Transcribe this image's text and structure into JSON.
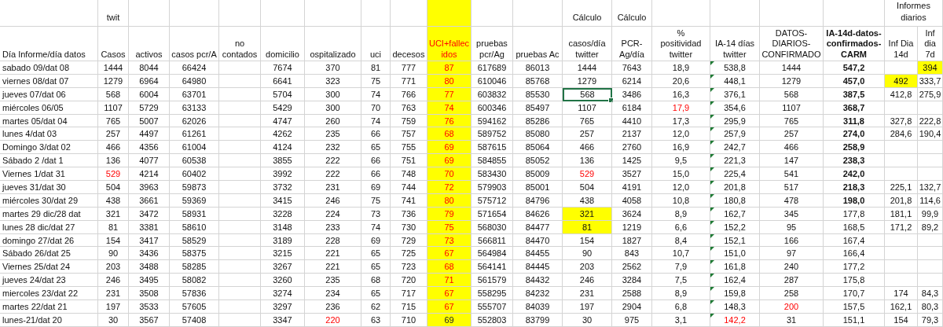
{
  "columns": [
    {
      "lines": [
        "Día Informe/día datos"
      ],
      "kind": "label"
    },
    {
      "lines": [
        "Casos"
      ],
      "kind": "plain",
      "group": "twit"
    },
    {
      "lines": [
        "activos"
      ],
      "kind": "plain"
    },
    {
      "lines": [
        "casos pcr/A"
      ],
      "kind": "plain"
    },
    {
      "lines": [
        "no",
        "contados"
      ],
      "kind": "plain"
    },
    {
      "lines": [
        "domicilio"
      ],
      "kind": "plain"
    },
    {
      "lines": [
        "ospitalizado"
      ],
      "kind": "plain"
    },
    {
      "lines": [
        "uci"
      ],
      "kind": "plain"
    },
    {
      "lines": [
        "decesos"
      ],
      "kind": "plain"
    },
    {
      "lines": [
        "UCI+fallec",
        "idos"
      ],
      "kind": "highlight"
    },
    {
      "lines": [
        "pruebas",
        "pcr/Ag"
      ],
      "kind": "plain"
    },
    {
      "lines": [
        "pruebas Ac"
      ],
      "kind": "plain"
    },
    {
      "lines": [
        "casos/día",
        "twitter"
      ],
      "kind": "plain",
      "group": "Cálculo"
    },
    {
      "lines": [
        "PCR-",
        "Ag/día"
      ],
      "kind": "plain",
      "group": "Cálculo"
    },
    {
      "lines": [
        "%",
        "positividad",
        "twitter"
      ],
      "kind": "plain"
    },
    {
      "lines": [
        "IA-14 días",
        "twitter"
      ],
      "kind": "notes"
    },
    {
      "lines": [
        "DATOS-",
        "DIARIOS-",
        "CONFIRMADO"
      ],
      "kind": "plain"
    },
    {
      "lines": [
        "IA-14d-datos-",
        "confirmados-",
        "CARM"
      ],
      "kind": "bold"
    },
    {
      "lines": [
        "Inf Dia",
        "14d"
      ],
      "kind": "plain",
      "group": "Informes diarios",
      "group_wide": true
    },
    {
      "lines": [
        "Inf",
        "dia",
        "7d"
      ],
      "kind": "plain"
    }
  ],
  "rows": [
    {
      "cells": [
        "sabado 09/dat 08",
        "1444",
        "8044",
        "66424",
        null,
        "7674",
        "370",
        "81",
        "777",
        "87",
        "617689",
        "86013",
        "1444",
        "7643",
        "18,9",
        "538,8",
        "1444",
        {
          "text": "547,2",
          "kind": "bold"
        },
        null,
        {
          "text": "394",
          "kind": "highlight"
        }
      ]
    },
    {
      "cells": [
        "viernes 08/dat 07",
        "1279",
        "6964",
        "64980",
        null,
        "6641",
        "323",
        "75",
        "771",
        "80",
        "610046",
        "85768",
        "1279",
        "6214",
        "20,6",
        "448,1",
        "1279",
        {
          "text": "457,0",
          "kind": "bold"
        },
        {
          "text": "492",
          "kind": "highlight"
        },
        "333,7"
      ]
    },
    {
      "cells": [
        "jueves 07/dat 06",
        "568",
        "6004",
        "63701",
        null,
        "5704",
        "300",
        "74",
        "766",
        "77",
        "603832",
        "85530",
        {
          "text": "568",
          "kind": "selected"
        },
        "3486",
        "16,3",
        "376,1",
        "568",
        {
          "text": "387,5",
          "kind": "bold"
        },
        "412,8",
        "275,9"
      ]
    },
    {
      "cells": [
        "miércoles 06/05",
        "1107",
        "5729",
        "63133",
        null,
        "5429",
        "300",
        "70",
        "763",
        "74",
        "600346",
        "85497",
        "1107",
        "6184",
        {
          "text": "17,9",
          "kind": "red"
        },
        "354,6",
        "1107",
        {
          "text": "368,7",
          "kind": "bold"
        },
        null,
        null
      ]
    },
    {
      "cells": [
        "martes 05/dat 04",
        "765",
        "5007",
        "62026",
        null,
        "4747",
        "260",
        "74",
        "759",
        "76",
        "594162",
        "85286",
        "765",
        "4410",
        "17,3",
        "295,9",
        "765",
        {
          "text": "311,8",
          "kind": "bold"
        },
        "327,8",
        "222,8"
      ]
    },
    {
      "cells": [
        "lunes 4/dat 03",
        "257",
        "4497",
        "61261",
        null,
        "4262",
        "235",
        "66",
        "757",
        "68",
        "589752",
        "85080",
        "257",
        "2137",
        "12,0",
        "257,9",
        "257",
        {
          "text": "274,0",
          "kind": "bold"
        },
        "284,6",
        "190,4"
      ]
    },
    {
      "cells": [
        "Domingo 3/dat 02",
        "466",
        "4356",
        "61004",
        null,
        "4124",
        "232",
        "65",
        "755",
        "69",
        "587615",
        "85064",
        "466",
        "2760",
        "16,9",
        "242,7",
        "466",
        {
          "text": "258,9",
          "kind": "bold"
        },
        null,
        null
      ]
    },
    {
      "cells": [
        "Sábado 2 /dat 1",
        "136",
        "4077",
        "60538",
        null,
        "3855",
        "222",
        "66",
        "751",
        "69",
        "584855",
        "85052",
        "136",
        "1425",
        "9,5",
        "221,3",
        "147",
        {
          "text": "238,3",
          "kind": "bold"
        },
        null,
        null
      ]
    },
    {
      "cells": [
        "Viernes 1/dat 31",
        {
          "text": "529",
          "kind": "red"
        },
        "4214",
        "60402",
        null,
        "3992",
        "222",
        "66",
        "748",
        "70",
        "583430",
        "85009",
        {
          "text": "529",
          "kind": "red"
        },
        "3527",
        "15,0",
        "225,4",
        "541",
        {
          "text": "242,0",
          "kind": "bold"
        },
        null,
        null
      ]
    },
    {
      "cells": [
        "jueves 31/dat 30",
        "504",
        "3963",
        "59873",
        null,
        "3732",
        "231",
        "69",
        "744",
        "72",
        "579903",
        "85001",
        "504",
        "4191",
        "12,0",
        "201,8",
        "517",
        {
          "text": "218,3",
          "kind": "bold"
        },
        "225,1",
        "132,7"
      ]
    },
    {
      "cells": [
        "miércoles 30/dat 29",
        "438",
        "3661",
        "59369",
        null,
        "3415",
        "246",
        "75",
        "741",
        "80",
        "575712",
        "84796",
        "438",
        "4058",
        "10,8",
        "180,8",
        "478",
        {
          "text": "198,0",
          "kind": "bold"
        },
        "201,8",
        "114,6"
      ]
    },
    {
      "cells": [
        "martes 29 dic/28 dat",
        "321",
        "3472",
        "58931",
        null,
        "3228",
        "224",
        "73",
        "736",
        "79",
        "571654",
        "84626",
        {
          "text": "321",
          "kind": "highlight"
        },
        "3624",
        "8,9",
        "162,7",
        "345",
        "177,8",
        "181,1",
        "99,9"
      ]
    },
    {
      "cells": [
        "lunes 28 dic/dat 27",
        "81",
        "3381",
        "58610",
        null,
        "3148",
        "233",
        "74",
        "730",
        "75",
        "568030",
        "84477",
        {
          "text": "81",
          "kind": "highlight"
        },
        "1219",
        "6,6",
        "152,2",
        "95",
        "168,5",
        "171,2",
        "89,2"
      ]
    },
    {
      "cells": [
        "domingo 27/dat 26",
        "154",
        "3417",
        "58529",
        null,
        "3189",
        "228",
        "69",
        "729",
        "73",
        "566811",
        "84470",
        "154",
        "1827",
        "8,4",
        "152,1",
        "166",
        "167,4",
        null,
        null
      ]
    },
    {
      "cells": [
        "Sábado 26/dat 25",
        "90",
        "3436",
        "58375",
        null,
        "3215",
        "221",
        "65",
        "725",
        "67",
        "564984",
        "84455",
        "90",
        "843",
        "10,7",
        "151,0",
        "97",
        "166,4",
        null,
        null
      ]
    },
    {
      "cells": [
        "Viernes 25/dat 24",
        "203",
        "3488",
        "58285",
        null,
        "3267",
        "221",
        "65",
        "723",
        "68",
        "564141",
        "84445",
        "203",
        "2562",
        "7,9",
        "161,8",
        "240",
        "177,2",
        null,
        null
      ]
    },
    {
      "cells": [
        "jueves 24/dat 23",
        "246",
        "3495",
        "58082",
        null,
        "3260",
        "235",
        "68",
        "720",
        "71",
        "561579",
        "84432",
        "246",
        "3284",
        "7,5",
        "162,4",
        "287",
        "175,8",
        null,
        null
      ]
    },
    {
      "cells": [
        "miercoles 23/dat 22",
        "231",
        "3508",
        "57836",
        null,
        "3274",
        "234",
        "65",
        "717",
        "67",
        "558295",
        "84232",
        "231",
        "2588",
        "8,9",
        "159,8",
        "258",
        "170,7",
        "174",
        "84,3"
      ]
    },
    {
      "cells": [
        "martes 22/dat 21",
        "197",
        "3533",
        "57605",
        null,
        "3297",
        "236",
        "62",
        "715",
        "67",
        "555707",
        "84039",
        "197",
        "2904",
        "6,8",
        "148,3",
        {
          "text": "200",
          "kind": "red"
        },
        "157,5",
        "162,1",
        "80,3"
      ]
    },
    {
      "cells": [
        "lunes-21/dat 20",
        "30",
        "3567",
        "57408",
        null,
        "3347",
        {
          "text": "220",
          "kind": "red"
        },
        "63",
        "710",
        {
          "text": "69",
          "kind": "plain"
        },
        "552803",
        "83799",
        "30",
        "975",
        "3,1",
        {
          "text": "142,2",
          "kind": "red"
        },
        "31",
        "151,1",
        "154",
        "79,3"
      ]
    }
  ]
}
